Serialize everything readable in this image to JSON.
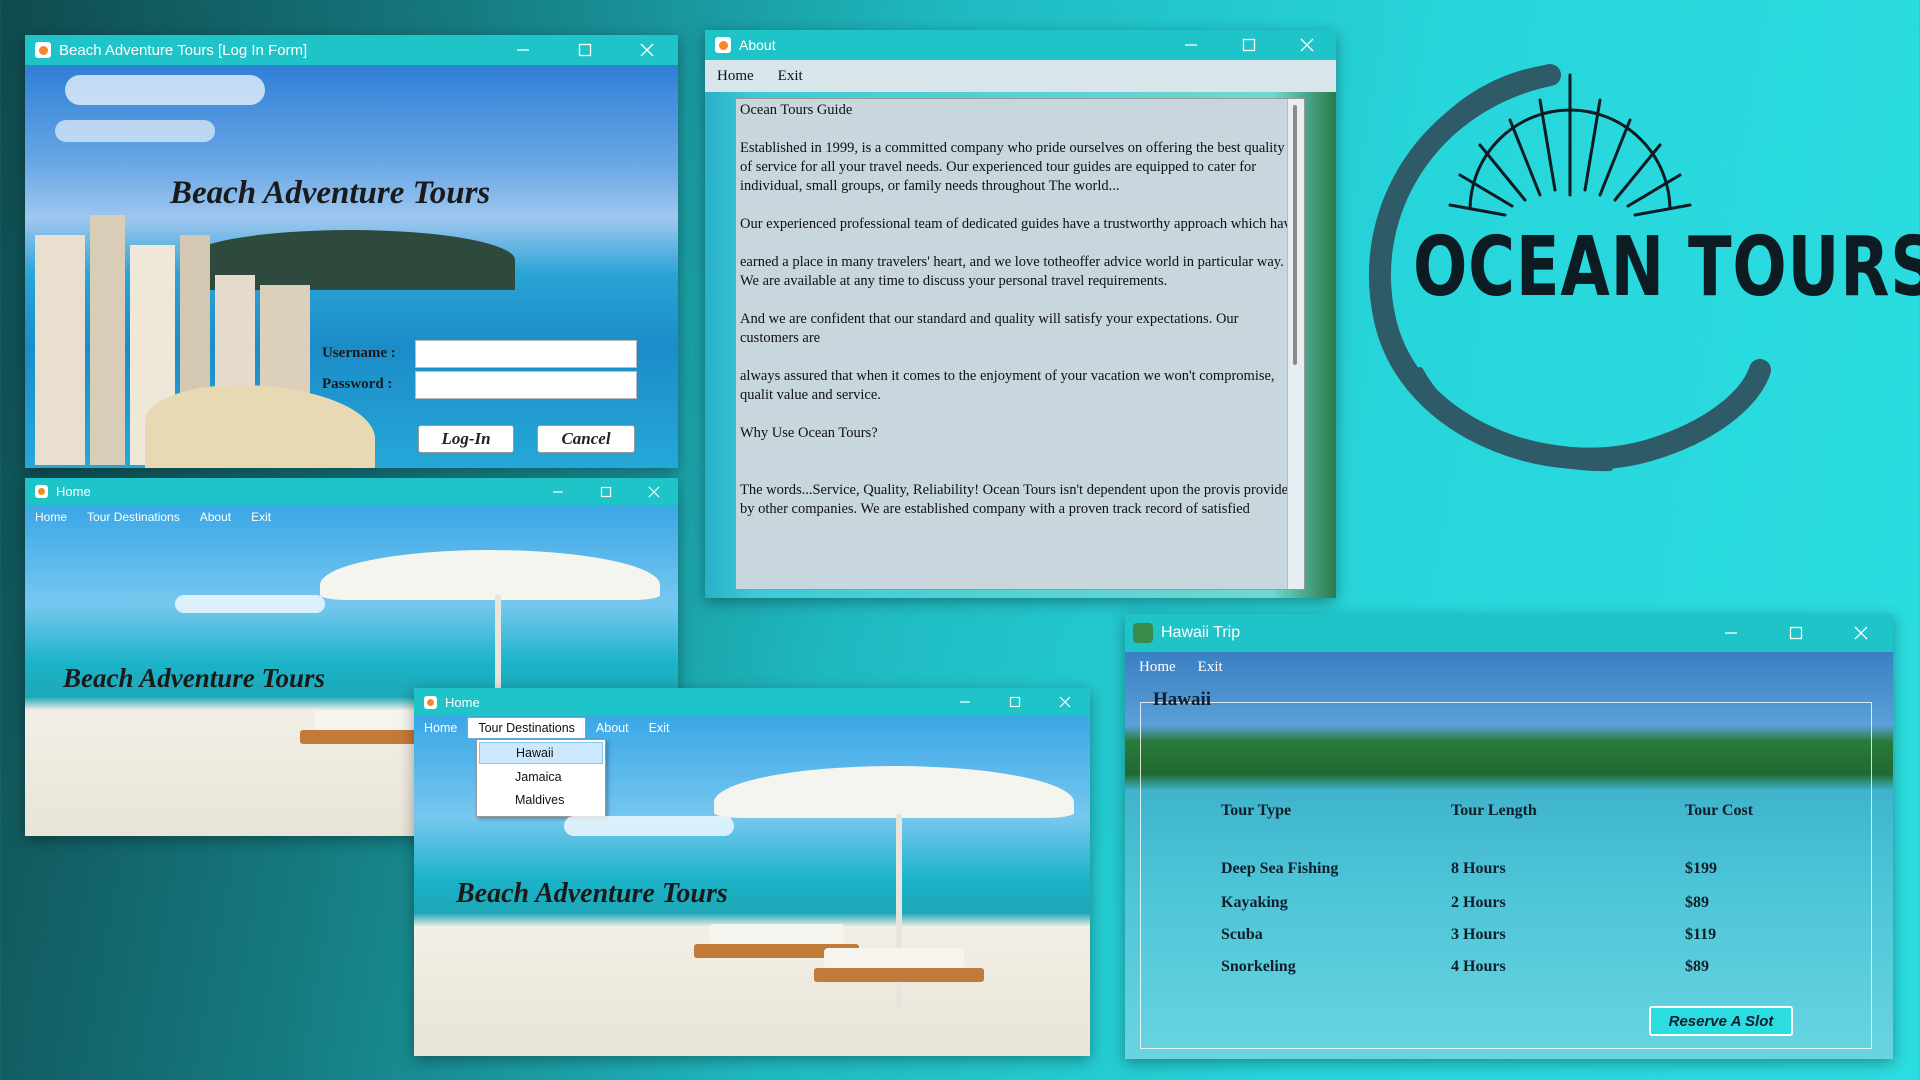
{
  "login": {
    "title": "Beach Adventure Tours [Log In Form]",
    "heading": "Beach Adventure Tours",
    "username_label": "Username :",
    "password_label": "Password :",
    "username_value": "",
    "password_value": "",
    "login_button": "Log-In",
    "cancel_button": "Cancel"
  },
  "about": {
    "title": "About",
    "menu": [
      "Home",
      "Exit"
    ],
    "paragraphs": [
      "Ocean Tours Guide",
      "Established in 1999, is a committed company who pride ourselves on offering the best quality of service for all your travel needs. Our experienced tour guides are equipped to cater for individual, small groups, or family needs throughout The world...",
      "Our experienced professional team of dedicated guides have a trustworthy approach which have",
      "earned a place in many travelers' heart, and we love totheoffer advice world in particular way. We are available at any time to discuss your personal travel requirements.",
      "And we are confident that our standard and quality will satisfy your expectations. Our customers are",
      "always assured that when it comes to the enjoyment of your vacation we won't compromise, qualit value and service.",
      "Why Use Ocean Tours?",
      "The words...Service, Quality, Reliability! Ocean Tours isn't dependent upon the provis provided by other companies. We are established company with a proven track record of satisfied"
    ]
  },
  "logo": {
    "text": "OCEAN TOURS"
  },
  "home1": {
    "title": "Home",
    "menu": [
      "Home",
      "Tour Destinations",
      "About",
      "Exit"
    ],
    "heading": "Beach Adventure Tours"
  },
  "home2": {
    "title": "Home",
    "menu": [
      "Home",
      "Tour Destinations",
      "About",
      "Exit"
    ],
    "dropdown": [
      "Hawaii",
      "Jamaica",
      "Maldives"
    ],
    "heading": "Beach Adventure Tours"
  },
  "hawaii": {
    "title": "Hawaii Trip",
    "menu": [
      "Home",
      "Exit"
    ],
    "group_label": "Hawaii",
    "headers": [
      "Tour Type",
      "Tour Length",
      "Tour Cost"
    ],
    "rows": [
      [
        "Deep Sea Fishing",
        "8 Hours",
        "$199"
      ],
      [
        "Kayaking",
        "2 Hours",
        "$89"
      ],
      [
        "Scuba",
        "3 Hours",
        "$119"
      ],
      [
        "Snorkeling",
        "4 Hours",
        "$89"
      ]
    ],
    "reserve_button": "Reserve A Slot"
  },
  "colors": {
    "titlebar": "#1fc4c8",
    "accent": "#2bdde0",
    "logo_ink": "#0d1b22",
    "logo_brush": "#2f5a67"
  }
}
